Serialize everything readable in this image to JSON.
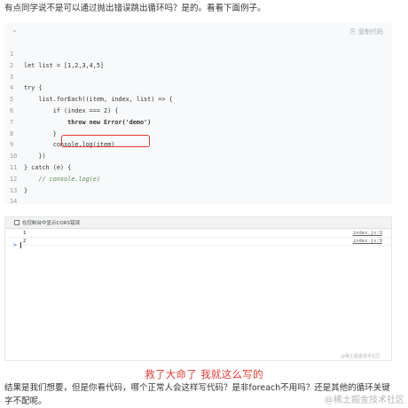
{
  "intro_text": "有点同学说不是可以通过抛出错误跳出循环吗？是的。看看下面例子。",
  "code_block": {
    "chevron": "⌄",
    "copy_label": "复制代码",
    "lines": [
      {
        "n": "1",
        "code": ""
      },
      {
        "n": "2",
        "code": "let list = [1,2,3,4,5]"
      },
      {
        "n": "3",
        "code": ""
      },
      {
        "n": "4",
        "code": "try {"
      },
      {
        "n": "5",
        "code": "    list.forEach((item, index, list) => {"
      },
      {
        "n": "6",
        "code": "        if (index === 2) {"
      },
      {
        "n": "7",
        "code": "            throw new Error('demo')"
      },
      {
        "n": "8",
        "code": "        }"
      },
      {
        "n": "9",
        "code": "        console.log(item)"
      },
      {
        "n": "10",
        "code": "    })"
      },
      {
        "n": "11",
        "code": "} catch (e) {"
      },
      {
        "n": "12",
        "code": "    // console.log(e)"
      },
      {
        "n": "13",
        "code": "}"
      },
      {
        "n": "14",
        "code": ""
      }
    ]
  },
  "console": {
    "cors_label": "在控制台中显示CORS错误",
    "rows": [
      {
        "value": "1",
        "source": "index.js:9"
      },
      {
        "value": "2",
        "source": "index.js:9"
      }
    ],
    "prompt": ">",
    "watermark": "@稀土掘金技术社区"
  },
  "caption": "救了大命了    我就这么写的",
  "outro_text": "结果是我们想要，但是你看代码，哪个正常人会这样写代码？是非foreach不用吗？还是其他的循环关键字不配呢。",
  "watermark": "@稀土掘金技术社区",
  "colors": {
    "highlight_box": "#e53935",
    "caption": "#e53935"
  }
}
